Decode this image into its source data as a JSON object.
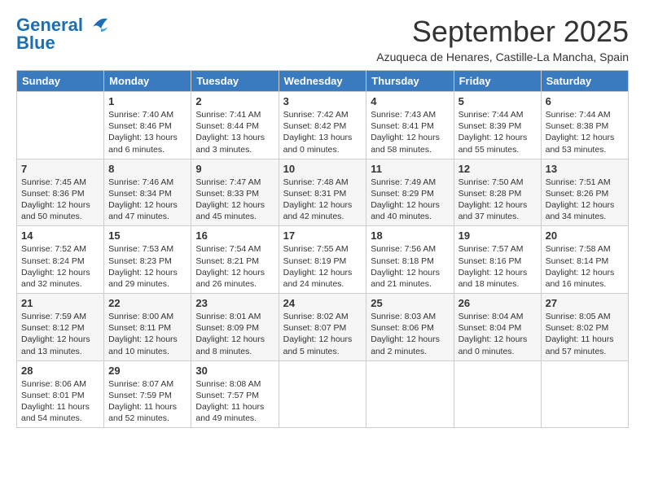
{
  "logo": {
    "line1": "General",
    "line2": "Blue"
  },
  "title": "September 2025",
  "subtitle": "Azuqueca de Henares, Castille-La Mancha, Spain",
  "days_of_week": [
    "Sunday",
    "Monday",
    "Tuesday",
    "Wednesday",
    "Thursday",
    "Friday",
    "Saturday"
  ],
  "weeks": [
    [
      {
        "num": "",
        "info": ""
      },
      {
        "num": "1",
        "info": "Sunrise: 7:40 AM\nSunset: 8:46 PM\nDaylight: 13 hours\nand 6 minutes."
      },
      {
        "num": "2",
        "info": "Sunrise: 7:41 AM\nSunset: 8:44 PM\nDaylight: 13 hours\nand 3 minutes."
      },
      {
        "num": "3",
        "info": "Sunrise: 7:42 AM\nSunset: 8:42 PM\nDaylight: 13 hours\nand 0 minutes."
      },
      {
        "num": "4",
        "info": "Sunrise: 7:43 AM\nSunset: 8:41 PM\nDaylight: 12 hours\nand 58 minutes."
      },
      {
        "num": "5",
        "info": "Sunrise: 7:44 AM\nSunset: 8:39 PM\nDaylight: 12 hours\nand 55 minutes."
      },
      {
        "num": "6",
        "info": "Sunrise: 7:44 AM\nSunset: 8:38 PM\nDaylight: 12 hours\nand 53 minutes."
      }
    ],
    [
      {
        "num": "7",
        "info": "Sunrise: 7:45 AM\nSunset: 8:36 PM\nDaylight: 12 hours\nand 50 minutes."
      },
      {
        "num": "8",
        "info": "Sunrise: 7:46 AM\nSunset: 8:34 PM\nDaylight: 12 hours\nand 47 minutes."
      },
      {
        "num": "9",
        "info": "Sunrise: 7:47 AM\nSunset: 8:33 PM\nDaylight: 12 hours\nand 45 minutes."
      },
      {
        "num": "10",
        "info": "Sunrise: 7:48 AM\nSunset: 8:31 PM\nDaylight: 12 hours\nand 42 minutes."
      },
      {
        "num": "11",
        "info": "Sunrise: 7:49 AM\nSunset: 8:29 PM\nDaylight: 12 hours\nand 40 minutes."
      },
      {
        "num": "12",
        "info": "Sunrise: 7:50 AM\nSunset: 8:28 PM\nDaylight: 12 hours\nand 37 minutes."
      },
      {
        "num": "13",
        "info": "Sunrise: 7:51 AM\nSunset: 8:26 PM\nDaylight: 12 hours\nand 34 minutes."
      }
    ],
    [
      {
        "num": "14",
        "info": "Sunrise: 7:52 AM\nSunset: 8:24 PM\nDaylight: 12 hours\nand 32 minutes."
      },
      {
        "num": "15",
        "info": "Sunrise: 7:53 AM\nSunset: 8:23 PM\nDaylight: 12 hours\nand 29 minutes."
      },
      {
        "num": "16",
        "info": "Sunrise: 7:54 AM\nSunset: 8:21 PM\nDaylight: 12 hours\nand 26 minutes."
      },
      {
        "num": "17",
        "info": "Sunrise: 7:55 AM\nSunset: 8:19 PM\nDaylight: 12 hours\nand 24 minutes."
      },
      {
        "num": "18",
        "info": "Sunrise: 7:56 AM\nSunset: 8:18 PM\nDaylight: 12 hours\nand 21 minutes."
      },
      {
        "num": "19",
        "info": "Sunrise: 7:57 AM\nSunset: 8:16 PM\nDaylight: 12 hours\nand 18 minutes."
      },
      {
        "num": "20",
        "info": "Sunrise: 7:58 AM\nSunset: 8:14 PM\nDaylight: 12 hours\nand 16 minutes."
      }
    ],
    [
      {
        "num": "21",
        "info": "Sunrise: 7:59 AM\nSunset: 8:12 PM\nDaylight: 12 hours\nand 13 minutes."
      },
      {
        "num": "22",
        "info": "Sunrise: 8:00 AM\nSunset: 8:11 PM\nDaylight: 12 hours\nand 10 minutes."
      },
      {
        "num": "23",
        "info": "Sunrise: 8:01 AM\nSunset: 8:09 PM\nDaylight: 12 hours\nand 8 minutes."
      },
      {
        "num": "24",
        "info": "Sunrise: 8:02 AM\nSunset: 8:07 PM\nDaylight: 12 hours\nand 5 minutes."
      },
      {
        "num": "25",
        "info": "Sunrise: 8:03 AM\nSunset: 8:06 PM\nDaylight: 12 hours\nand 2 minutes."
      },
      {
        "num": "26",
        "info": "Sunrise: 8:04 AM\nSunset: 8:04 PM\nDaylight: 12 hours\nand 0 minutes."
      },
      {
        "num": "27",
        "info": "Sunrise: 8:05 AM\nSunset: 8:02 PM\nDaylight: 11 hours\nand 57 minutes."
      }
    ],
    [
      {
        "num": "28",
        "info": "Sunrise: 8:06 AM\nSunset: 8:01 PM\nDaylight: 11 hours\nand 54 minutes."
      },
      {
        "num": "29",
        "info": "Sunrise: 8:07 AM\nSunset: 7:59 PM\nDaylight: 11 hours\nand 52 minutes."
      },
      {
        "num": "30",
        "info": "Sunrise: 8:08 AM\nSunset: 7:57 PM\nDaylight: 11 hours\nand 49 minutes."
      },
      {
        "num": "",
        "info": ""
      },
      {
        "num": "",
        "info": ""
      },
      {
        "num": "",
        "info": ""
      },
      {
        "num": "",
        "info": ""
      }
    ]
  ]
}
